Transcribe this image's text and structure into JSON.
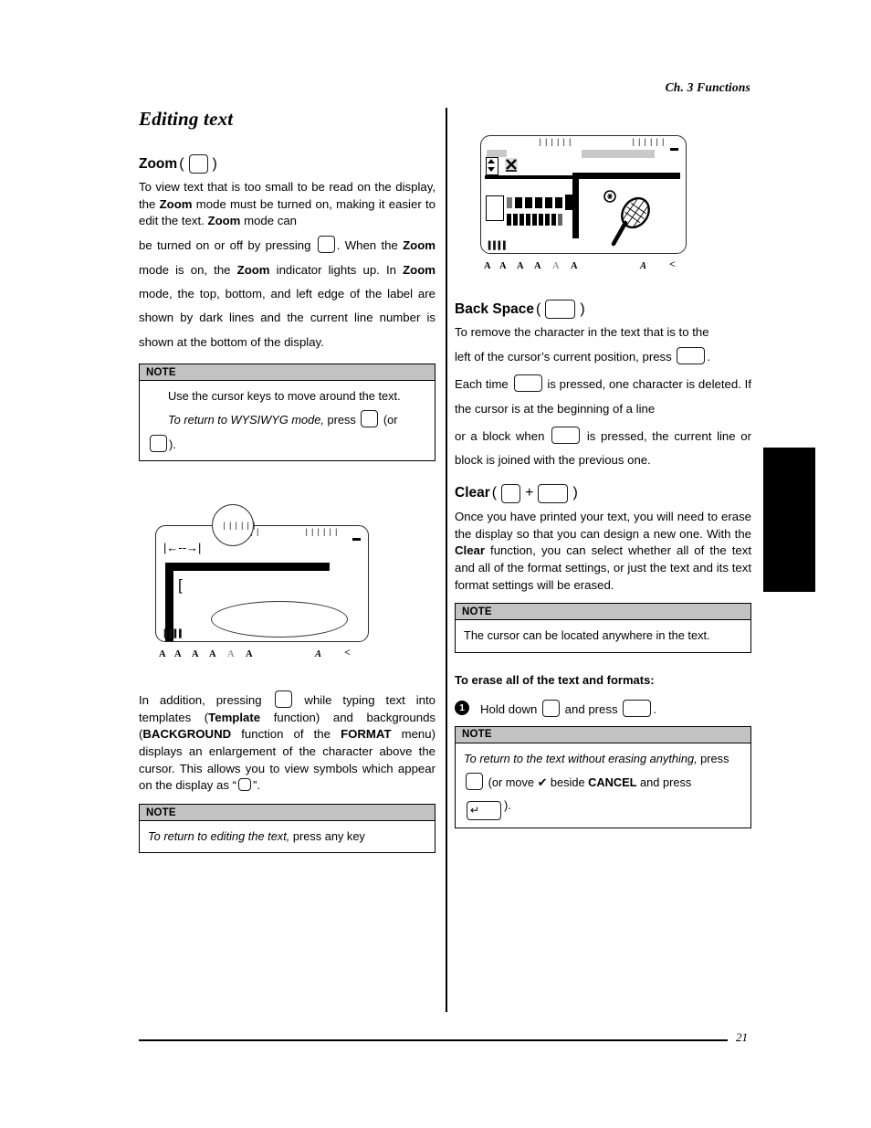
{
  "header": {
    "running_head": "Ch. 3 Functions"
  },
  "footer": {
    "page_number": "21"
  },
  "left_column": {
    "section_title": "Editing text",
    "zoom": {
      "heading": "Zoom",
      "paren_open": "(",
      "paren_close": ")",
      "p1_a": "To view text that is too small to be read on the display, the ",
      "p1_b": "Zoom",
      "p1_c": " mode must be turned on, making it easier to edit the text. ",
      "p1_d": "Zoom",
      "p1_e": " mode can",
      "p2_a": "be turned on or off by pressing ",
      "p2_b": ". When the ",
      "p2_c": "Zoom",
      "p2_d": " mode is on, the ",
      "p2_e": "Zoom",
      "p2_f": " indicator lights up. In ",
      "p2_g": "Zoom",
      "p2_h": " mode, the top, bottom, and left edge of the label are shown by dark lines and the current line number is shown at the bottom of the display."
    },
    "note1": {
      "title": "NOTE",
      "line1": "Use the cursor keys to move around the text.",
      "line2_italic": "To return to WYSIWYG mode,",
      "line2_rest": " press ",
      "line2_or": "(or",
      "line3_close": ")."
    },
    "lcd": {
      "indicators": [
        "A",
        "A",
        "A",
        "A",
        "A",
        "A",
        "A",
        "<"
      ],
      "tick_left": "▐▐▐▐",
      "tick_center": "||||||",
      "tick_right": "||||||",
      "arrow_glyph": "|←--→|",
      "bracket_glyph": "["
    },
    "addendum": {
      "a": "In addition, pressing ",
      "b": " while typing text into templates (",
      "c": "Template",
      "d": " function) and backgrounds (",
      "e": "BACKGROUND",
      "f": " function of the ",
      "g": "FORMAT",
      "h": " menu) displays an enlargement of the character above the cursor. This allows you to view symbols which appear on the display as “",
      "i": "”."
    },
    "note2": {
      "title": "NOTE",
      "italic": "To return to editing the text,",
      "rest": " press any key"
    }
  },
  "right_column": {
    "lcd": {
      "tick_center": "||||||",
      "tick_right": "||||||",
      "tick_bottom_left": "▐▐▐▐",
      "indicators": [
        "A",
        "A",
        "A",
        "A",
        "A",
        "A",
        "A",
        "<"
      ],
      "spinner_icon": "spinner-icon",
      "x_icon": "x-icon",
      "graphic": "tennis-racket-graphic"
    },
    "back_space": {
      "heading": "Back Space",
      "paren_open": "(",
      "paren_close": ")",
      "p1": "To remove the character in the text that is to the",
      "p2_a": "left of the cursor’s current position, press ",
      "p2_b": ".",
      "p3_a": "Each time ",
      "p3_b": " is pressed, one character is deleted. If the cursor is at the beginning of a line",
      "p4_a": "or a block when ",
      "p4_b": " is pressed, the current line or block is joined with the previous one."
    },
    "clear": {
      "heading": "Clear",
      "paren_open": "(",
      "plus": "+",
      "paren_close": ")",
      "p1_a": "Once you have printed your text, you will need to erase the display so that you can design a new one. With the ",
      "p1_b": "Clear",
      "p1_c": " function, you can select whether all of the text and all of the format settings, or just the text and its text format settings will be erased."
    },
    "note3": {
      "title": "NOTE",
      "text": "The cursor can be located anywhere in the text."
    },
    "procedure": {
      "heading": "To erase all of the text and formats:",
      "step_number": "1",
      "step_a": "Hold down ",
      "step_b": " and press ",
      "step_c": "."
    },
    "note4": {
      "title": "NOTE",
      "italic": "To return to the text without erasing anything,",
      "rest": " press",
      "line2_a": "(or move ",
      "check": "✔",
      "line2_b": " beside ",
      "line2_bold": "CANCEL",
      "line2_c": " and press",
      "ret_glyph": "↵",
      "line3_close": ")."
    }
  },
  "colors": {
    "note_header_bg": "#c2c2c2",
    "ink": "#000000",
    "paper": "#ffffff",
    "lcd_gray": "#c8c8c8"
  }
}
